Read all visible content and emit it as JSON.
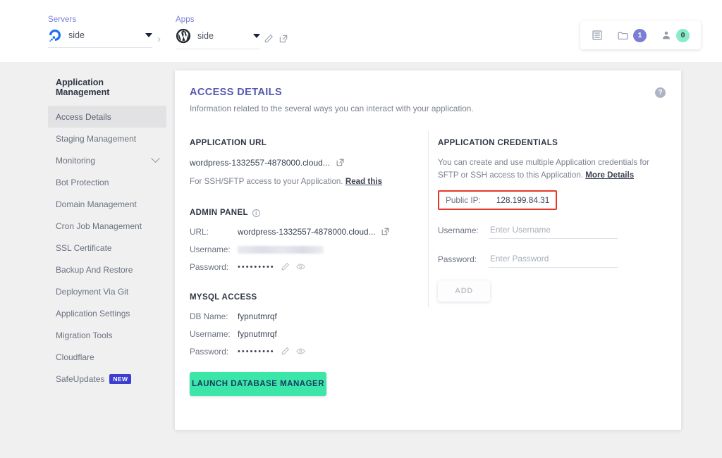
{
  "topbar": {
    "servers": {
      "label": "Servers",
      "name": "side",
      "icon": "digitalocean-logo"
    },
    "apps": {
      "label": "Apps",
      "name": "side",
      "icon": "wordpress-logo"
    },
    "separator": "›",
    "tools": {
      "list_icon": "list-icon",
      "folder_icon": "folder-icon",
      "folder_count": "1",
      "user_icon": "user-icon",
      "user_count": "0",
      "badge_purple": "#7b7fd4",
      "badge_green": "#88ecc6"
    }
  },
  "sidebar": {
    "title": "Application Management",
    "items": [
      {
        "label": "Access Details",
        "active": true,
        "chevron": false,
        "badge": ""
      },
      {
        "label": "Staging Management",
        "active": false,
        "chevron": false,
        "badge": ""
      },
      {
        "label": "Monitoring",
        "active": false,
        "chevron": true,
        "badge": ""
      },
      {
        "label": "Bot Protection",
        "active": false,
        "chevron": false,
        "badge": ""
      },
      {
        "label": "Domain Management",
        "active": false,
        "chevron": false,
        "badge": ""
      },
      {
        "label": "Cron Job Management",
        "active": false,
        "chevron": false,
        "badge": ""
      },
      {
        "label": "SSL Certificate",
        "active": false,
        "chevron": false,
        "badge": ""
      },
      {
        "label": "Backup And Restore",
        "active": false,
        "chevron": false,
        "badge": ""
      },
      {
        "label": "Deployment Via Git",
        "active": false,
        "chevron": false,
        "badge": ""
      },
      {
        "label": "Application Settings",
        "active": false,
        "chevron": false,
        "badge": ""
      },
      {
        "label": "Migration Tools",
        "active": false,
        "chevron": false,
        "badge": ""
      },
      {
        "label": "Cloudflare",
        "active": false,
        "chevron": false,
        "badge": ""
      },
      {
        "label": "SafeUpdates",
        "active": false,
        "chevron": false,
        "badge": "NEW"
      }
    ]
  },
  "card": {
    "title": "ACCESS DETAILS",
    "subtitle": "Information related to the several ways you can interact with your application.",
    "help_icon": "?"
  },
  "application_url": {
    "heading": "APPLICATION URL",
    "url": "wordpress-1332557-4878000.cloud...",
    "note_text": "For SSH/SFTP access to your Application.",
    "note_link": "Read this"
  },
  "admin_panel": {
    "heading": "ADMIN PANEL",
    "info_icon": "i",
    "url_label": "URL:",
    "url_value": "wordpress-1332557-4878000.cloud...",
    "username_label": "Username:",
    "username_value": "",
    "password_label": "Password:",
    "password_value": "•••••••••"
  },
  "mysql_access": {
    "heading": "MYSQL ACCESS",
    "db_name_label": "DB Name:",
    "db_name_value": "fypnutmrqf",
    "username_label": "Username:",
    "username_value": "fypnutmrqf",
    "password_label": "Password:",
    "password_value": "•••••••••",
    "launch_button": "LAUNCH DATABASE MANAGER"
  },
  "application_credentials": {
    "heading": "APPLICATION CREDENTIALS",
    "description": "You can create and use multiple Application credentials for SFTP or SSH access to this Application.",
    "description_link": "More Details",
    "public_ip_label": "Public IP:",
    "public_ip_value": "128.199.84.31",
    "highlight_color": "#e8372a",
    "username_label": "Username:",
    "username_placeholder": "Enter Username",
    "username_value": "",
    "password_label": "Password:",
    "password_placeholder": "Enter Password",
    "password_value": "",
    "add_button": "ADD"
  }
}
